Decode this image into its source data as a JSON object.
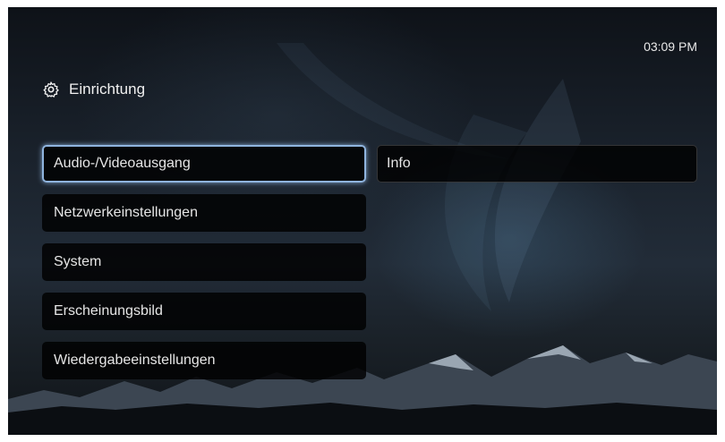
{
  "clock": "03:09 PM",
  "header": {
    "title": "Einrichtung",
    "icon": "gear-icon"
  },
  "menu": {
    "items": [
      {
        "label": "Audio-/Videoausgang",
        "selected": true
      },
      {
        "label": "Netzwerkeinstellungen",
        "selected": false
      },
      {
        "label": "System",
        "selected": false
      },
      {
        "label": "Erscheinungsbild",
        "selected": false
      },
      {
        "label": "Wiedergabeeinstellungen",
        "selected": false
      }
    ]
  },
  "submenu": {
    "items": [
      {
        "label": "Info"
      }
    ]
  },
  "colors": {
    "selection": "#8fb4de",
    "text": "#e6e6e6"
  }
}
